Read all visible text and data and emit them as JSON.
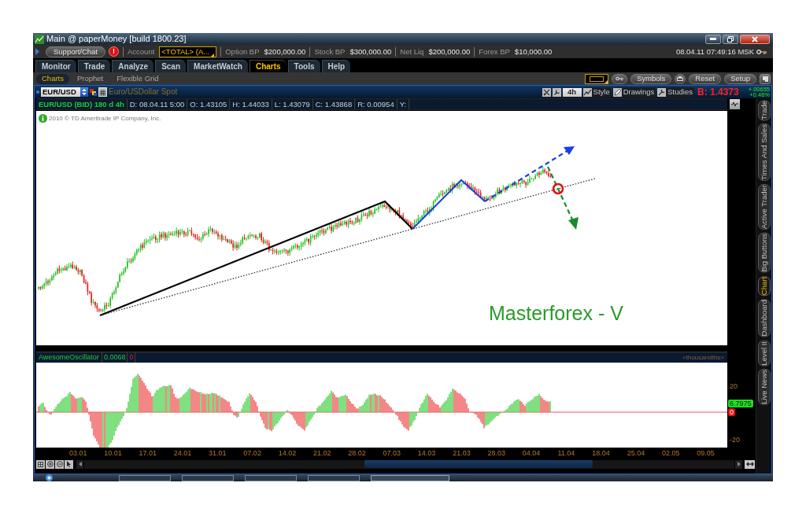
{
  "window": {
    "title": "Main @ paperMoney [build 1800.23]"
  },
  "account_bar": {
    "support_button": "Support/Chat",
    "alert_badge": "!",
    "account_label": "Account",
    "account_value": "<TOTAL> (A...",
    "balances": [
      {
        "label": "Option BP",
        "value": "$200,000.00"
      },
      {
        "label": "Stock BP",
        "value": "$300,000.00"
      },
      {
        "label": "Net Liq",
        "value": "$200,000.00"
      },
      {
        "label": "Forex BP",
        "value": "$10,000.00"
      }
    ],
    "datetime": "08.04.11 07:49:16 MSK"
  },
  "tabs": [
    {
      "label": "Monitor",
      "selected": false
    },
    {
      "label": "Trade",
      "selected": false
    },
    {
      "label": "Analyze",
      "selected": false
    },
    {
      "label": "Scan",
      "selected": false
    },
    {
      "label": "MarketWatch",
      "selected": false
    },
    {
      "label": "Charts",
      "selected": true
    },
    {
      "label": "Tools",
      "selected": false
    },
    {
      "label": "Help",
      "selected": false
    }
  ],
  "subtabs": [
    {
      "label": "Charts",
      "selected": true
    },
    {
      "label": "Prophet",
      "selected": false
    },
    {
      "label": "Flexible Grid",
      "selected": false
    }
  ],
  "toolbar_buttons": [
    "Symbols",
    "Reset",
    "Setup"
  ],
  "chart_header": {
    "symbol": "EUR/USD",
    "description": "Euro/USDollar Spot",
    "aggregation": "4h",
    "tools": [
      "Style",
      "Drawings",
      "Studies"
    ],
    "bid": "B: 1.4373",
    "change": "+.00655",
    "change_percent": "+0.46%"
  },
  "info_bar": [
    {
      "kind": "title",
      "text": "EUR/USD (BID) 180 d 4h"
    },
    {
      "kind": "value",
      "text": "D: 08.04.11 5:00"
    },
    {
      "kind": "value",
      "text": "O: 1.43105"
    },
    {
      "kind": "value",
      "text": "H: 1.44033"
    },
    {
      "kind": "value",
      "text": "L: 1.43079"
    },
    {
      "kind": "value",
      "text": "C: 1.43868"
    },
    {
      "kind": "value",
      "text": "R: 0.00954"
    },
    {
      "kind": "value",
      "text": "Y:"
    }
  ],
  "price_chart": {
    "copyright": "2010 © TD Ameritrade IP Company, Inc.",
    "annotation": "Masterforex - V"
  },
  "oscillator": {
    "name": "AwesomeOscillator",
    "value": "0.0068",
    "signal": "0",
    "units": "<thousandths>",
    "axis": [
      {
        "kind": "tick",
        "text": "20"
      },
      {
        "kind": "current",
        "text": "6.7975"
      },
      {
        "kind": "zero",
        "text": "0"
      },
      {
        "kind": "tick",
        "text": "-20"
      }
    ]
  },
  "date_axis": [
    "03.01",
    "10.01",
    "17.01",
    "24.01",
    "31.01",
    "07.02",
    "14.02",
    "21.02",
    "28.02",
    "07.03",
    "14.03",
    "21.03",
    "28.03",
    "04.04",
    "11.04",
    "18.04",
    "25.04",
    "02.05",
    "09.05"
  ],
  "side_tabs": [
    {
      "label": "Trade",
      "selected": false
    },
    {
      "label": "Times And Sales",
      "selected": false
    },
    {
      "label": "Active Trader",
      "selected": false
    },
    {
      "label": "Big Buttons",
      "selected": false
    },
    {
      "label": "Chart",
      "selected": true
    },
    {
      "label": "Dashboard",
      "selected": false
    },
    {
      "label": "Level II",
      "selected": false
    },
    {
      "label": "Live News",
      "selected": false
    }
  ]
}
